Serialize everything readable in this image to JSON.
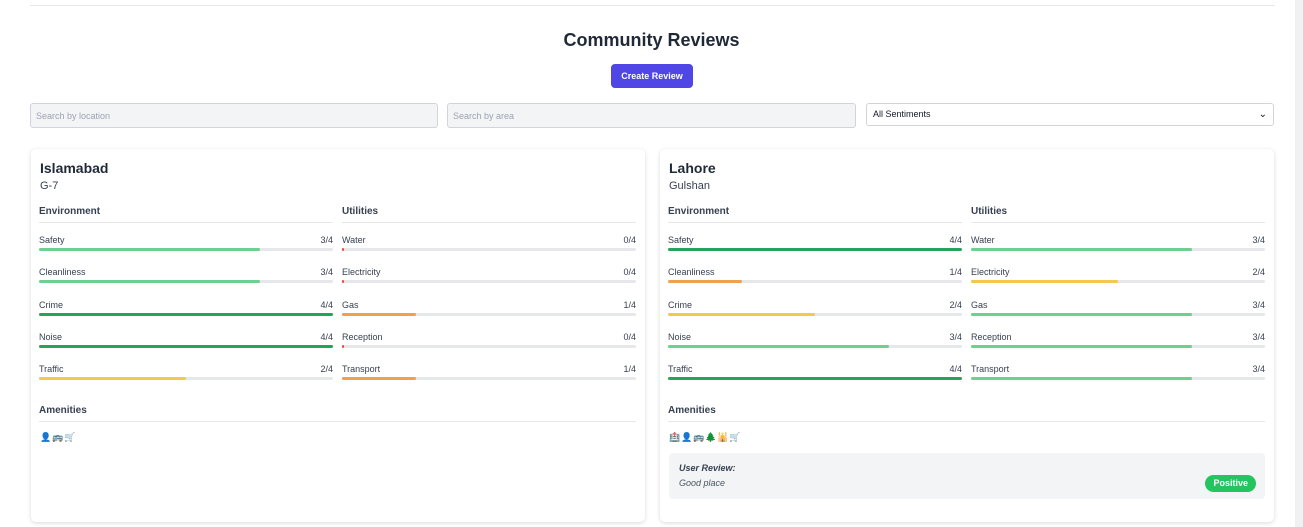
{
  "page": {
    "title": "Community Reviews",
    "create_button": "Create Review"
  },
  "filters": {
    "location_placeholder": "Search by location",
    "area_placeholder": "Search by area",
    "sentiment_selected": "All Sentiments"
  },
  "colors": {
    "high": "#22a55b",
    "good": "#6dd08f",
    "mid": "#f2c94c",
    "low": "#f0a14a",
    "zero": "#ef4444",
    "accent": "#4f46e5",
    "positive": "#22c55e"
  },
  "labels": {
    "environment": "Environment",
    "utilities": "Utilities",
    "amenities": "Amenities",
    "user_review": "User Review:"
  },
  "cards": [
    {
      "city": "Islamabad",
      "area": "G-7",
      "environment": [
        {
          "label": "Safety",
          "value": "3/4",
          "score": 3
        },
        {
          "label": "Cleanliness",
          "value": "3/4",
          "score": 3
        },
        {
          "label": "Crime",
          "value": "4/4",
          "score": 4
        },
        {
          "label": "Noise",
          "value": "4/4",
          "score": 4
        },
        {
          "label": "Traffic",
          "value": "2/4",
          "score": 2
        }
      ],
      "utilities": [
        {
          "label": "Water",
          "value": "0/4",
          "score": 0
        },
        {
          "label": "Electricity",
          "value": "0/4",
          "score": 0
        },
        {
          "label": "Gas",
          "value": "1/4",
          "score": 1
        },
        {
          "label": "Reception",
          "value": "0/4",
          "score": 0
        },
        {
          "label": "Transport",
          "value": "1/4",
          "score": 1
        }
      ],
      "amenities": [
        "person-icon",
        "bus-icon",
        "cart-icon"
      ],
      "amenity_glyphs": [
        "👤",
        "🚌",
        "🛒"
      ]
    },
    {
      "city": "Lahore",
      "area": "Gulshan",
      "environment": [
        {
          "label": "Safety",
          "value": "4/4",
          "score": 4
        },
        {
          "label": "Cleanliness",
          "value": "1/4",
          "score": 1
        },
        {
          "label": "Crime",
          "value": "2/4",
          "score": 2
        },
        {
          "label": "Noise",
          "value": "3/4",
          "score": 3
        },
        {
          "label": "Traffic",
          "value": "4/4",
          "score": 4
        }
      ],
      "utilities": [
        {
          "label": "Water",
          "value": "3/4",
          "score": 3
        },
        {
          "label": "Electricity",
          "value": "2/4",
          "score": 2
        },
        {
          "label": "Gas",
          "value": "3/4",
          "score": 3
        },
        {
          "label": "Reception",
          "value": "3/4",
          "score": 3
        },
        {
          "label": "Transport",
          "value": "3/4",
          "score": 3
        }
      ],
      "amenities": [
        "hospital-icon",
        "person-icon",
        "bus-icon",
        "tree-icon",
        "mosque-icon",
        "cart-icon"
      ],
      "amenity_glyphs": [
        "🏥",
        "👤",
        "🚌",
        "🌲",
        "🕌",
        "🛒"
      ],
      "review": {
        "text": "Good place",
        "sentiment": "Positive"
      }
    }
  ]
}
